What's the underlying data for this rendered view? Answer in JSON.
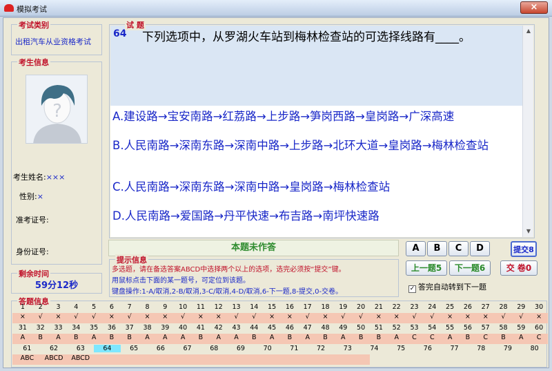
{
  "window": {
    "title": "模拟考试",
    "close_glyph": "×"
  },
  "sidebar": {
    "exam_type_title": "考试类别",
    "exam_type_value": "出租汽车从业资格考试",
    "info_title": "考生信息",
    "name_label": "考生姓名:",
    "name_value": "×××",
    "gender_label": "性别:",
    "gender_value": "×",
    "ticket_label": "准考证号:",
    "id_label": "身份证号:",
    "time_title": "剩余时间",
    "time_value": "59分12秒"
  },
  "question": {
    "section_title": "试  题",
    "number": "64",
    "text": "下列选项中，从罗湖火车站到梅林检查站的可选择线路有____。",
    "options": [
      "A.建设路→宝安南路→红荔路→上步路→笋岗西路→皇岗路→广深高速",
      "B.人民南路→深南东路→深南中路→上步路→北环大道→皇岗路→梅林检查站",
      "C.人民南路→深南东路→深南中路→皇岗路→梅林检查站",
      "D.人民南路→爱国路→丹平快速→布吉路→南坪快速路"
    ]
  },
  "status": {
    "text": "本题未作答"
  },
  "hint": {
    "title": "提示信息",
    "lines": [
      "多选题，请在备选答案ABCD中选择两个以上的选项，选完必须按“提交”键。",
      "用鼠标点击下面的某一题号，可定位到该题。",
      "键盘操作:1-A/取消,2-B/取消,3-C/取消,4-D/取消,6-下一题,8-提交,0-交卷。"
    ]
  },
  "controls": {
    "answers": [
      "A",
      "B",
      "C",
      "D"
    ],
    "submit_label": "提交8",
    "prev_label": "上一题5",
    "next_label": "下一题6",
    "finish_label": "交 卷0",
    "auto_next_label": "答完自动转到下一题",
    "auto_next_checked": true
  },
  "answer_grid": {
    "title": "答题信息",
    "current": 64,
    "rows": [
      {
        "numbers": [
          "1",
          "2",
          "3",
          "4",
          "5",
          "6",
          "7",
          "8",
          "9",
          "10",
          "11",
          "12",
          "13",
          "14",
          "15",
          "16",
          "17",
          "18",
          "19",
          "20",
          "21",
          "22",
          "23",
          "24",
          "25",
          "26",
          "27",
          "28",
          "29",
          "30"
        ],
        "answers": [
          "×",
          "√",
          "×",
          "√",
          "√",
          "×",
          "√",
          "×",
          "×",
          "√",
          "×",
          "×",
          "√",
          "√",
          "×",
          "×",
          "√",
          "×",
          "√",
          "√",
          "×",
          "×",
          "√",
          "√",
          "×",
          "×",
          "×",
          "√",
          "√",
          "×"
        ]
      },
      {
        "numbers": [
          "31",
          "32",
          "33",
          "34",
          "35",
          "36",
          "37",
          "38",
          "39",
          "40",
          "41",
          "42",
          "43",
          "44",
          "45",
          "46",
          "47",
          "48",
          "49",
          "50",
          "51",
          "52",
          "53",
          "54",
          "55",
          "56",
          "57",
          "58",
          "59",
          "60"
        ],
        "answers": [
          "A",
          "B",
          "A",
          "B",
          "A",
          "B",
          "B",
          "A",
          "A",
          "A",
          "B",
          "A",
          "A",
          "B",
          "A",
          "B",
          "A",
          "B",
          "A",
          "B",
          "B",
          "A",
          "C",
          "C",
          "A",
          "B",
          "C",
          "B",
          "A",
          "C"
        ]
      },
      {
        "numbers": [
          "61",
          "62",
          "63",
          "64",
          "65",
          "66",
          "67",
          "68",
          "69",
          "70",
          "71",
          "72",
          "73",
          "74",
          "75",
          "76",
          "77",
          "78",
          "79",
          "80"
        ],
        "answers": [
          "ABC",
          "ABCD",
          "ABCD",
          "",
          "",
          "",
          "",
          "",
          "",
          "",
          "",
          "",
          "",
          "",
          "",
          "",
          "",
          "",
          "",
          ""
        ]
      }
    ]
  },
  "colors": {
    "accent": "#1a28c8",
    "title_red": "#c0122a",
    "status_green": "#2f8c2f",
    "grid_bg": "#f5c7b4",
    "current_cell": "#7fe7ff"
  }
}
